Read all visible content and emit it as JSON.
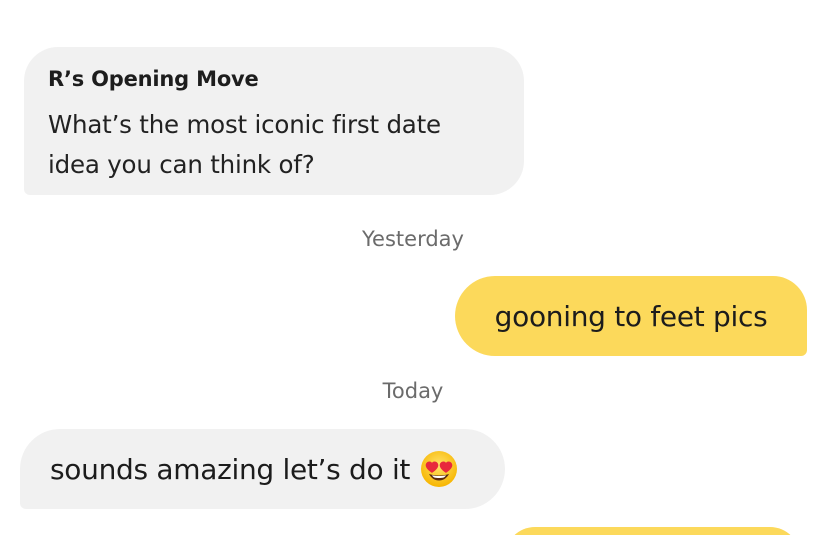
{
  "opening_move": {
    "title": "R’s Opening Move",
    "question_line1": "What’s the most iconic first date",
    "question_line2": "idea you can think of?"
  },
  "timestamps": {
    "yesterday": "Yesterday",
    "today": "Today"
  },
  "messages": [
    {
      "direction": "outgoing",
      "text": "gooning to feet pics"
    },
    {
      "direction": "incoming",
      "text": "sounds amazing let’s do it",
      "emoji": "heart-eyes-emoji-icon"
    }
  ],
  "colors": {
    "outgoing_bubble": "#fcd95b",
    "incoming_bubble": "#f1f1f1",
    "timestamp_text": "#6b6b6b"
  }
}
